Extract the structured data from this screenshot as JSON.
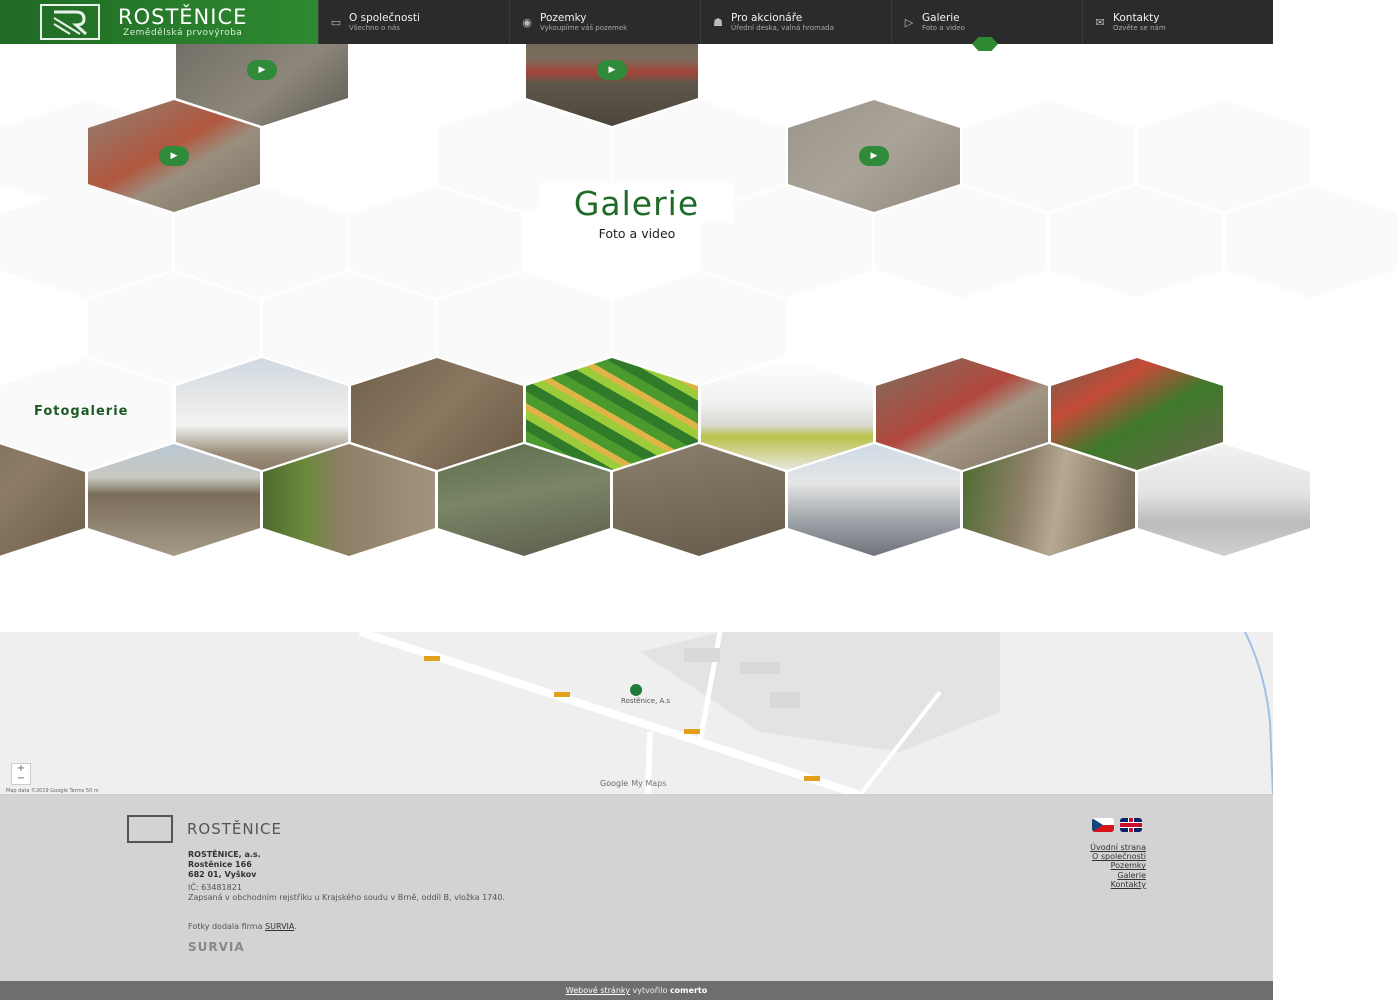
{
  "brand": {
    "name": "ROSTĚNICE",
    "subtitle": "Zemědělská prvovýroba"
  },
  "nav": [
    {
      "label": "O společnosti",
      "sub": "Všechno o nás",
      "icon": "document-icon"
    },
    {
      "label": "Pozemky",
      "sub": "Vykoupíme váš pozemek",
      "icon": "eye-icon"
    },
    {
      "label": "Pro akcionáře",
      "sub": "Úřední deska, valná hromada",
      "icon": "handshake-icon"
    },
    {
      "label": "Galerie",
      "sub": "Foto a video",
      "icon": "play-icon"
    },
    {
      "label": "Kontakty",
      "sub": "Ozvěte se nám",
      "icon": "envelope-icon"
    }
  ],
  "hero": {
    "title": "Galerie",
    "subtitle": "Foto a video"
  },
  "photo_section": {
    "label": "Fotogalerie"
  },
  "map": {
    "place_label": "Rostěnice, A.s",
    "credit": "Map data ©2019 Google   Terms   50 m",
    "google": "Google",
    "mymaps": "My Maps",
    "zoom_in": "+",
    "zoom_out": "−"
  },
  "footer": {
    "logo_name": "ROSTĚNICE",
    "company": "ROSTĚNICE, a.s.",
    "street": "Rostěnice 166",
    "city": "682 01, Vyškov",
    "ic": "IČ: 63481821",
    "register": "Zapsaná v obchodním rejstříku u Krajského soudu v Brně, oddíl B, vložka 1740.",
    "photos_prefix": "Fotky dodala firma",
    "photos_firm": "SURVIA",
    "survia_logo": "SURVIA",
    "links": [
      "Úvodní strana",
      "O společnosti",
      "Pozemky",
      "Galerie",
      "Kontakty"
    ]
  },
  "bottom": {
    "link": "Webové stránky",
    "middle": "vytvořilo",
    "brand": "comerto"
  },
  "colors": {
    "brand_green": "#2e8a30",
    "header_dark": "#2b2b2b",
    "footer_bg": "#d3d3d3"
  }
}
